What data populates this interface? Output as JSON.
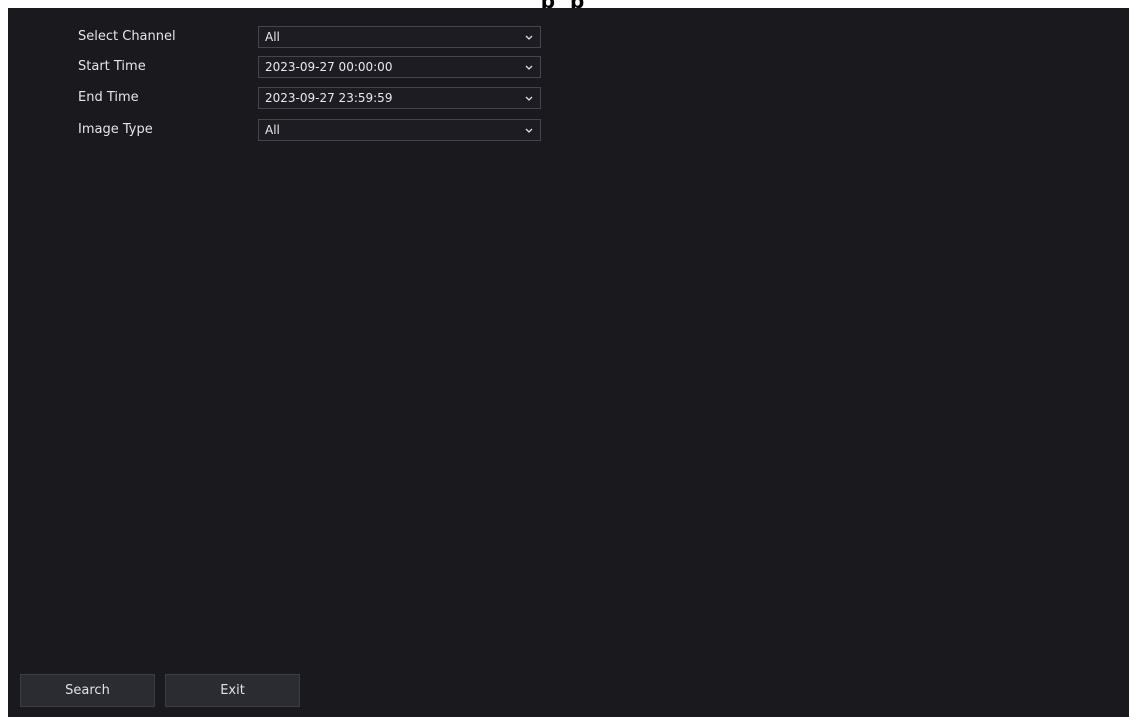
{
  "title_fragment": "p p",
  "form": {
    "fields": [
      {
        "label": "Select Channel",
        "value": "All"
      },
      {
        "label": "Start Time",
        "value": "2023-09-27 00:00:00"
      },
      {
        "label": "End Time",
        "value": "2023-09-27 23:59:59"
      },
      {
        "label": "Image Type",
        "value": "All"
      }
    ],
    "dropdown_icon": "chevron-down-icon"
  },
  "footer": {
    "search_label": "Search",
    "exit_label": "Exit"
  },
  "colors": {
    "background": "#19191e",
    "field_border": "#44464f",
    "button_bg": "#2b2b32",
    "text": "#e6e6e6"
  }
}
